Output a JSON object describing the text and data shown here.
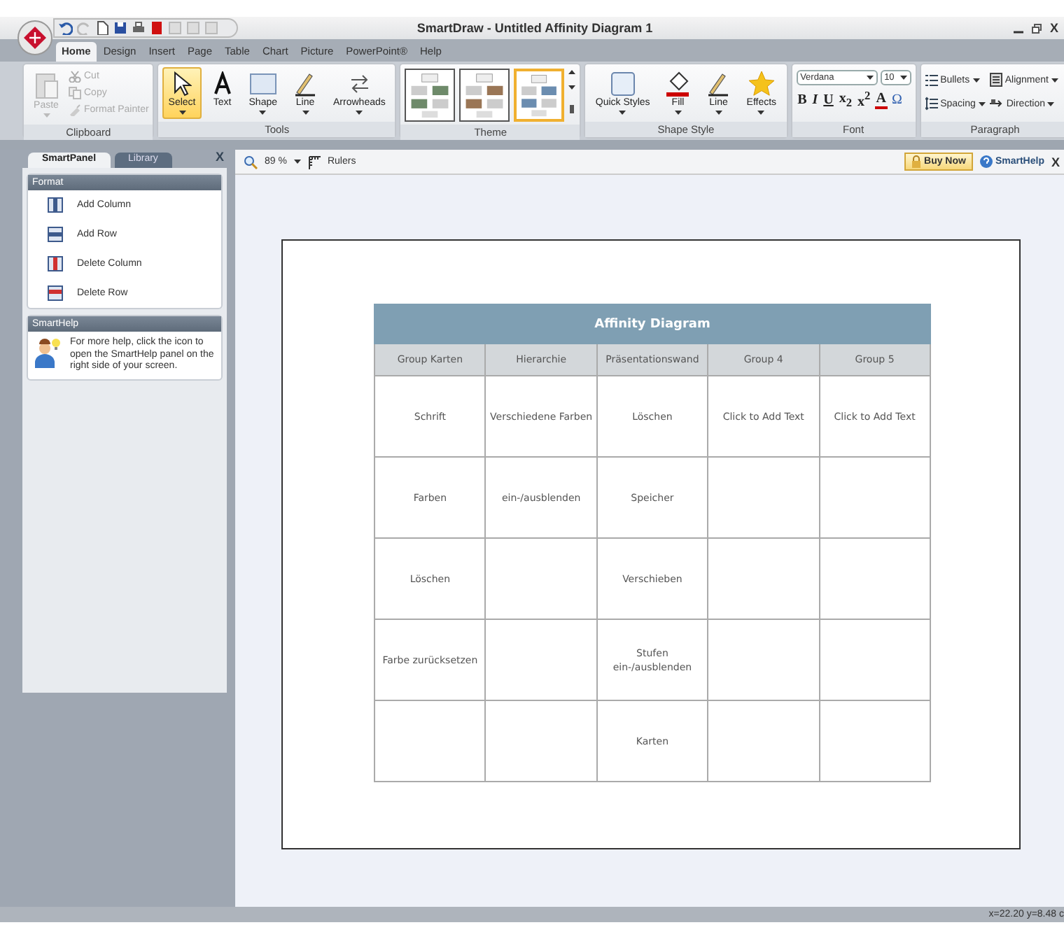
{
  "window": {
    "title": "SmartDraw - Untitled Affinity Diagram 1",
    "close": "X"
  },
  "menu_tabs": [
    {
      "label": "Home",
      "selected": true
    },
    {
      "label": "Design",
      "selected": false
    },
    {
      "label": "Insert",
      "selected": false
    },
    {
      "label": "Page",
      "selected": false
    },
    {
      "label": "Table",
      "selected": false
    },
    {
      "label": "Chart",
      "selected": false
    },
    {
      "label": "Picture",
      "selected": false
    },
    {
      "label": "PowerPoint®",
      "selected": false
    },
    {
      "label": "Help",
      "selected": false
    }
  ],
  "ribbon": [
    {
      "kind": "clipboard",
      "label": "Clipboard",
      "items": [
        {
          "label": "Paste",
          "disabled": true,
          "kind": "paste"
        },
        {
          "label": "Cut",
          "disabled": true,
          "kind": "cut"
        },
        {
          "label": "Copy",
          "disabled": true,
          "kind": "copy"
        },
        {
          "label": "Format Painter",
          "disabled": true,
          "kind": "painter"
        }
      ]
    },
    {
      "kind": "tools",
      "label": "Tools",
      "items": [
        {
          "label": "Select",
          "kind": "pointer",
          "selected": true,
          "dropdown": true
        },
        {
          "label": "Text",
          "kind": "text",
          "selected": false,
          "dropdown": false
        },
        {
          "label": "Shape",
          "kind": "shape",
          "selected": false,
          "dropdown": true
        },
        {
          "label": "Line",
          "kind": "pen",
          "selected": false,
          "dropdown": true
        },
        {
          "label": "Arrowheads",
          "kind": "arrows",
          "selected": false,
          "dropdown": true
        }
      ]
    },
    {
      "kind": "theme",
      "label": "Theme",
      "items": [
        {
          "selected": false,
          "color": "#6e8a6a"
        },
        {
          "selected": false,
          "color": "#9a7656"
        },
        {
          "selected": true,
          "color": "#6b8db0"
        }
      ]
    },
    {
      "kind": "tools",
      "label": "Shape Style",
      "items": [
        {
          "label": "Quick Styles",
          "kind": "style",
          "selected": false,
          "dropdown": true
        },
        {
          "label": "Fill",
          "kind": "fill",
          "selected": false,
          "dropdown": true
        },
        {
          "label": "Line",
          "kind": "pen",
          "selected": false,
          "dropdown": true
        },
        {
          "label": "Effects",
          "kind": "star",
          "selected": false,
          "dropdown": true
        }
      ]
    },
    {
      "kind": "font",
      "label": "Font",
      "font": "Verdana",
      "size": "10",
      "buttons": [
        "B",
        "I",
        "U",
        "x$_{2}$",
        "x$^{2}$",
        "A",
        "Ω"
      ]
    },
    {
      "kind": "paragraph",
      "label": "Paragraph",
      "items": [
        {
          "label": "Bullets",
          "kind": "bullets"
        },
        {
          "label": "Alignment",
          "kind": "align"
        },
        {
          "label": "Spacing",
          "kind": "spacing"
        },
        {
          "label": "Direction",
          "kind": "direction"
        }
      ]
    }
  ],
  "panel": {
    "tabs": [
      {
        "label": "SmartPanel",
        "selected": true
      },
      {
        "label": "Library",
        "selected": false
      }
    ],
    "close": "X",
    "format": {
      "title": "Format",
      "items": [
        {
          "label": "Add Column",
          "kind": "add-column"
        },
        {
          "label": "Add Row",
          "kind": "add-row"
        },
        {
          "label": "Delete Column",
          "kind": "delete-column"
        },
        {
          "label": "Delete Row",
          "kind": "delete-row"
        }
      ]
    },
    "help": {
      "title": "SmartHelp",
      "text": "For more help, click the icon to open the SmartHelp panel on the right side of your screen."
    }
  },
  "toolbar": {
    "zoom": "89 %",
    "rulers": "Rulers",
    "buy": "Buy Now",
    "help": "SmartHelp",
    "close": "X"
  },
  "diagram": {
    "title": "Affinity Diagram",
    "columns": [
      "Group Karten",
      "Hierarchie",
      "Präsentationswand",
      "Group 4",
      "Group 5"
    ],
    "rows": [
      [
        "Schrift",
        "Verschiedene Farben",
        "Löschen",
        "Click to Add Text",
        "Click to Add Text"
      ],
      [
        "Farben",
        "ein-/ausblenden",
        "Speicher",
        null,
        null
      ],
      [
        "Löschen",
        null,
        "Verschieben",
        null,
        null
      ],
      [
        "Farbe zurücksetzen",
        null,
        "Stufen\nein-/ausblenden",
        null,
        null
      ],
      [
        null,
        null,
        "Karten",
        null,
        null
      ]
    ]
  },
  "status_bar": "x=22.20  y=8.48 c"
}
